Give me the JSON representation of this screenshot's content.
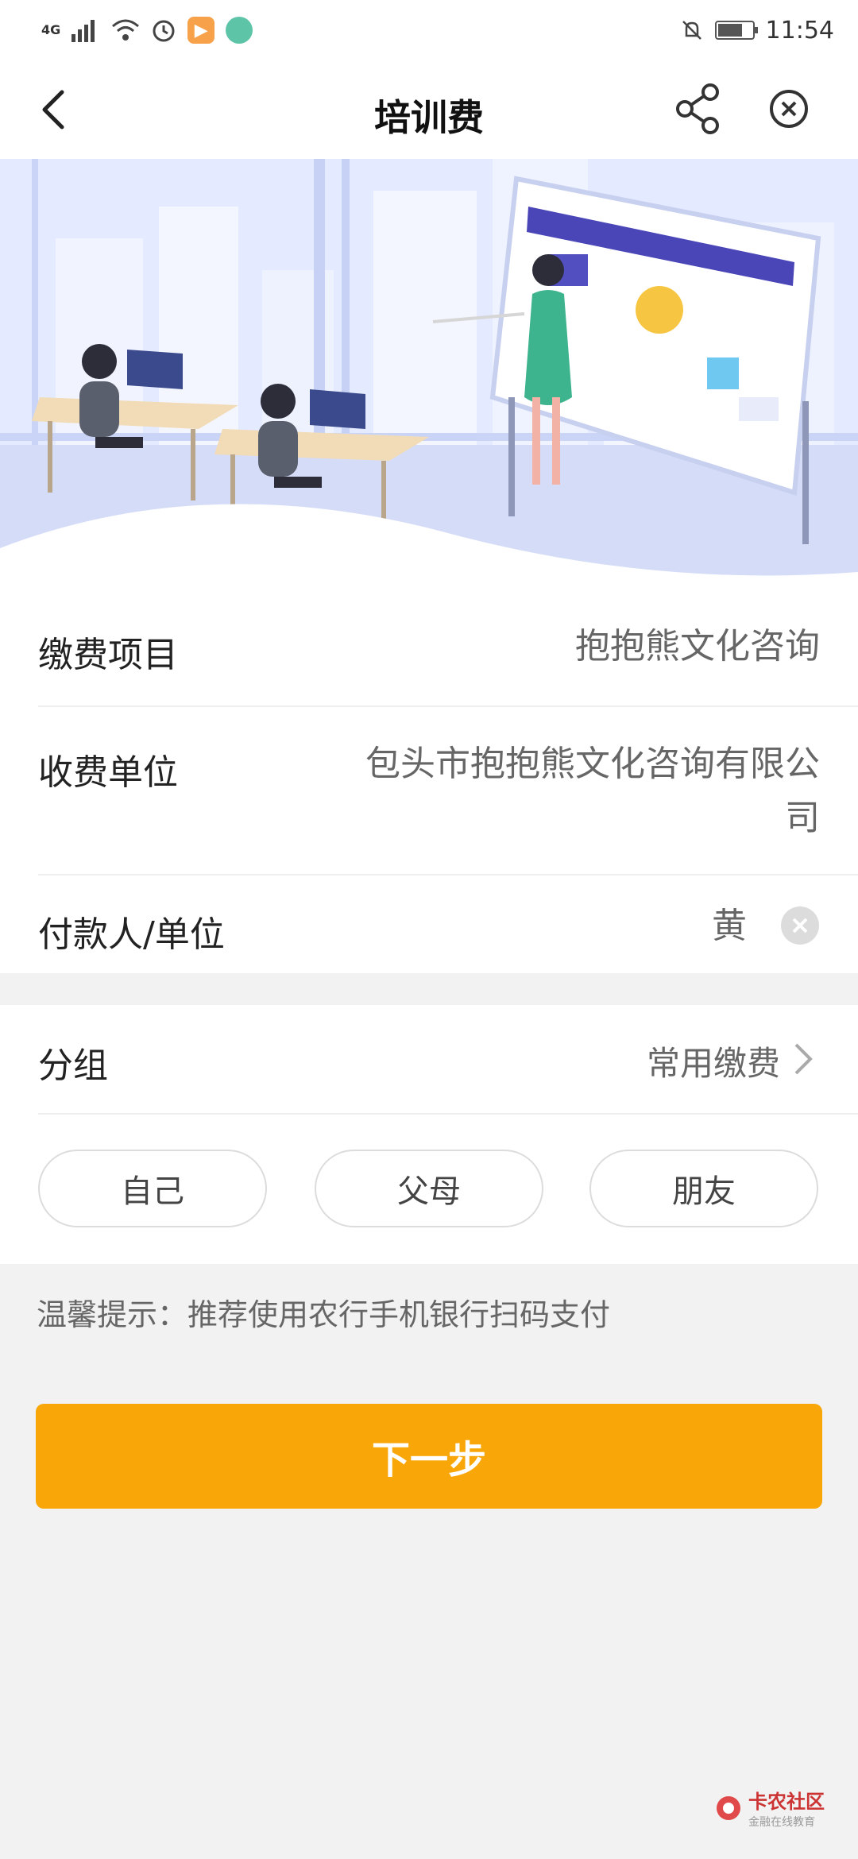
{
  "status_bar": {
    "network": "4G",
    "time": "11:54"
  },
  "nav": {
    "title": "培训费"
  },
  "fields": [
    {
      "label": "缴费项目",
      "value": "抱抱熊文化咨询"
    },
    {
      "label": "收费单位",
      "value_line1": "包头市抱抱熊文化咨询有限公",
      "value_line2": "司"
    },
    {
      "label": "付款人/单位",
      "value": "黄"
    }
  ],
  "group": {
    "label": "分组",
    "value": "常用缴费"
  },
  "chips": [
    "自己",
    "父母",
    "朋友"
  ],
  "tip": "温馨提示：推荐使用农行手机银行扫码支付",
  "next_button": "下一步",
  "watermark": {
    "title": "卡农社区",
    "subtitle": "金融在线教育"
  },
  "colors": {
    "accent": "#f9a708",
    "banner_bg": "#dfe7ff"
  }
}
